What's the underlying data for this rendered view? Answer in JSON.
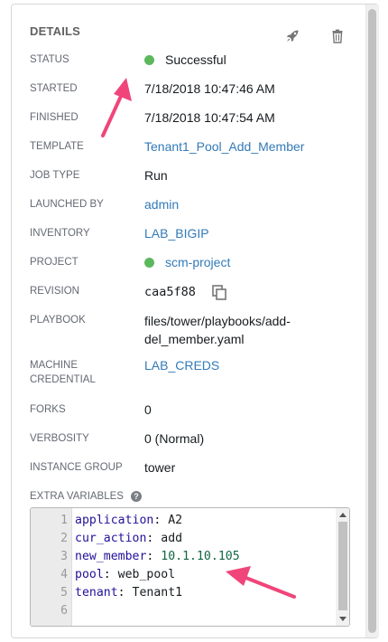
{
  "header": {
    "title": "DETAILS"
  },
  "icons": {
    "launch": "rocket-icon",
    "delete": "trash-icon",
    "copy": "copy-icon",
    "help": "help-icon"
  },
  "colors": {
    "success": "#5cb85c",
    "link": "#337ab7",
    "annotation_arrow": "#f0457a"
  },
  "fields": {
    "status": {
      "label": "STATUS",
      "value": "Successful"
    },
    "started": {
      "label": "STARTED",
      "value": "7/18/2018 10:47:46 AM"
    },
    "finished": {
      "label": "FINISHED",
      "value": "7/18/2018 10:47:54 AM"
    },
    "template": {
      "label": "TEMPLATE",
      "value": "Tenant1_Pool_Add_Member"
    },
    "job_type": {
      "label": "JOB TYPE",
      "value": "Run"
    },
    "launched_by": {
      "label": "LAUNCHED BY",
      "value": "admin"
    },
    "inventory": {
      "label": "INVENTORY",
      "value": "LAB_BIGIP"
    },
    "project": {
      "label": "PROJECT",
      "value": "scm-project"
    },
    "revision": {
      "label": "REVISION",
      "value": "caa5f88"
    },
    "playbook": {
      "label": "PLAYBOOK",
      "value_line1": "files/tower/playbooks/add-",
      "value_line2": "del_member.yaml"
    },
    "machine_credential": {
      "label_line1": "MACHINE",
      "label_line2": "CREDENTIAL",
      "value": "LAB_CREDS"
    },
    "forks": {
      "label": "FORKS",
      "value": "0"
    },
    "verbosity": {
      "label": "VERBOSITY",
      "value": "0 (Normal)"
    },
    "instance_group": {
      "label": "INSTANCE GROUP",
      "value": "tower"
    },
    "extra_variables": {
      "label": "EXTRA VARIABLES",
      "help_glyph": "?"
    }
  },
  "editor": {
    "lines": [
      {
        "num": "1",
        "key": "application",
        "value": "A2",
        "kind": "str"
      },
      {
        "num": "2",
        "key": "cur_action",
        "value": "add",
        "kind": "str"
      },
      {
        "num": "3",
        "key": "new_member",
        "value": "10.1.10.105",
        "kind": "num"
      },
      {
        "num": "4",
        "key": "pool",
        "value": "web_pool",
        "kind": "str"
      },
      {
        "num": "5",
        "key": "tenant",
        "value": "Tenant1",
        "kind": "str"
      },
      {
        "num": "6",
        "key": "",
        "value": "",
        "kind": "empty"
      }
    ]
  }
}
